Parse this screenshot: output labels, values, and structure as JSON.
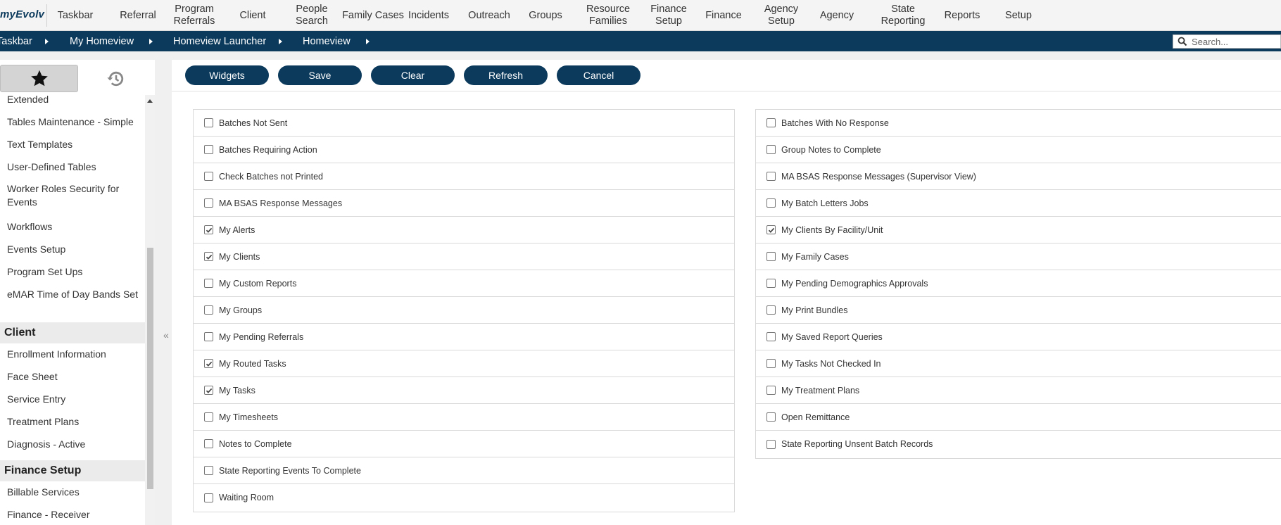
{
  "app": {
    "logo": "myEvolv"
  },
  "nav": {
    "items": [
      {
        "label": "Taskbar"
      },
      {
        "label": "Referral"
      },
      {
        "label": "Program\nReferrals"
      },
      {
        "label": "Client"
      },
      {
        "label": "People\nSearch"
      },
      {
        "label": "Family Cases"
      },
      {
        "label": "Incidents"
      },
      {
        "label": "Outreach"
      },
      {
        "label": "Groups"
      },
      {
        "label": "Resource\nFamilies"
      },
      {
        "label": "Finance\nSetup"
      },
      {
        "label": "Finance"
      },
      {
        "label": "Agency\nSetup"
      },
      {
        "label": "Agency"
      },
      {
        "label": "State\nReporting"
      },
      {
        "label": "Reports"
      },
      {
        "label": "Setup"
      }
    ]
  },
  "breadcrumb": {
    "items": [
      "Taskbar",
      "My Homeview",
      "Homeview Launcher",
      "Homeview"
    ]
  },
  "search": {
    "placeholder": "Search..."
  },
  "sidebar": {
    "tabs": {
      "favorites_icon": "star-icon",
      "history_icon": "history-icon"
    },
    "entries": [
      {
        "type": "item",
        "label": "Extended"
      },
      {
        "type": "item",
        "label": "Tables Maintenance - Simple"
      },
      {
        "type": "item",
        "label": "Text Templates"
      },
      {
        "type": "item",
        "label": "User-Defined Tables"
      },
      {
        "type": "item",
        "label": "Worker Roles Security for Events"
      },
      {
        "type": "item",
        "label": "Workflows"
      },
      {
        "type": "item",
        "label": "Events Setup"
      },
      {
        "type": "item",
        "label": "Program Set Ups"
      },
      {
        "type": "item",
        "label": "eMAR Time of Day Bands Set"
      },
      {
        "type": "header",
        "label": "Client"
      },
      {
        "type": "item",
        "label": "Enrollment Information"
      },
      {
        "type": "item",
        "label": "Face Sheet"
      },
      {
        "type": "item",
        "label": "Service Entry"
      },
      {
        "type": "item",
        "label": "Treatment Plans"
      },
      {
        "type": "item",
        "label": "Diagnosis - Active"
      },
      {
        "type": "header",
        "label": "Finance Setup"
      },
      {
        "type": "item",
        "label": "Billable Services"
      },
      {
        "type": "item",
        "label": "Finance - Receiver"
      }
    ]
  },
  "toolbar": {
    "buttons": [
      "Widgets",
      "Save",
      "Clear",
      "Refresh",
      "Cancel"
    ]
  },
  "widgets": {
    "left": [
      {
        "label": "Batches Not Sent",
        "checked": false
      },
      {
        "label": "Batches Requiring Action",
        "checked": false
      },
      {
        "label": "Check Batches not Printed",
        "checked": false
      },
      {
        "label": "MA BSAS Response Messages",
        "checked": false
      },
      {
        "label": "My Alerts",
        "checked": true
      },
      {
        "label": "My Clients",
        "checked": true
      },
      {
        "label": "My Custom Reports",
        "checked": false
      },
      {
        "label": "My Groups",
        "checked": false
      },
      {
        "label": "My Pending Referrals",
        "checked": false
      },
      {
        "label": "My Routed Tasks",
        "checked": true
      },
      {
        "label": "My Tasks",
        "checked": true
      },
      {
        "label": "My Timesheets",
        "checked": false
      },
      {
        "label": "Notes to Complete",
        "checked": false
      },
      {
        "label": "State Reporting Events To Complete",
        "checked": false
      },
      {
        "label": "Waiting Room",
        "checked": false
      }
    ],
    "right": [
      {
        "label": "Batches With No Response",
        "checked": false
      },
      {
        "label": "Group Notes to Complete",
        "checked": false
      },
      {
        "label": "MA BSAS Response Messages (Supervisor View)",
        "checked": false
      },
      {
        "label": "My Batch Letters Jobs",
        "checked": false
      },
      {
        "label": "My Clients By Facility/Unit",
        "checked": true
      },
      {
        "label": "My Family Cases",
        "checked": false
      },
      {
        "label": "My Pending Demographics Approvals",
        "checked": false
      },
      {
        "label": "My Print Bundles",
        "checked": false
      },
      {
        "label": "My Saved Report Queries",
        "checked": false
      },
      {
        "label": "My Tasks Not Checked In",
        "checked": false
      },
      {
        "label": "My Treatment Plans",
        "checked": false
      },
      {
        "label": "Open Remittance",
        "checked": false
      },
      {
        "label": "State Reporting Unsent Batch Records",
        "checked": false
      }
    ]
  }
}
